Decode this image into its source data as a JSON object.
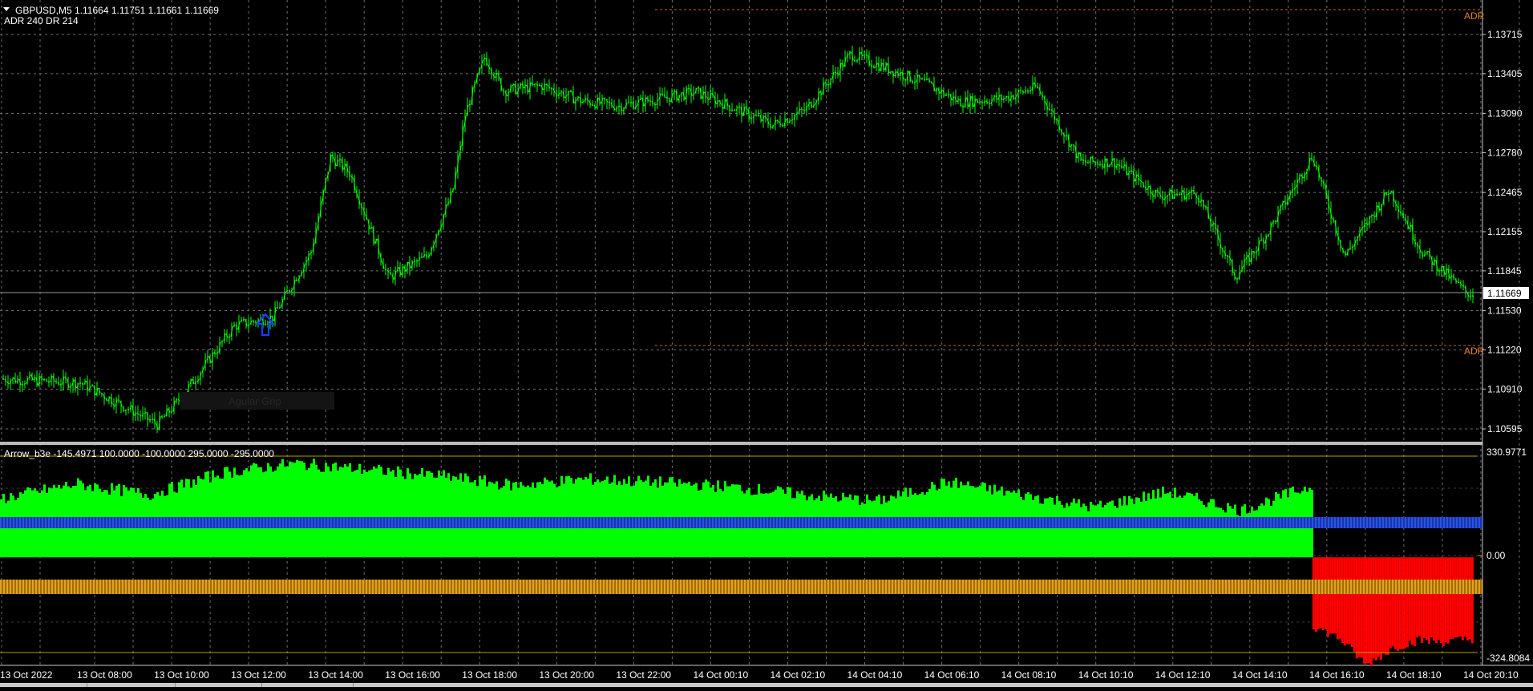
{
  "header": {
    "symbol_line": "GBPUSD,M5  1.11664 1.11751 1.11661 1.11669",
    "adr_line": "ADR 240  DR 214"
  },
  "price_axis": {
    "ticks": [
      "1.13715",
      "1.13405",
      "1.13090",
      "1.12780",
      "1.12465",
      "1.12155",
      "1.11845",
      "1.11530",
      "1.11220",
      "1.10910",
      "1.10595"
    ],
    "current_price": "1.11669"
  },
  "adr_labels": {
    "upper": "ADR",
    "lower": "ADR"
  },
  "faded_label": "Agular Grip",
  "indicator": {
    "title": "Arrow_b3e -145.4971 100.0000 -100.0000 295.0000 -295.0000",
    "axis_top": "330.9771",
    "axis_zero": "0.00",
    "axis_bottom": "-324.8084"
  },
  "time_axis": [
    "13 Oct 2022",
    "13 Oct 08:00",
    "13 Oct 10:00",
    "13 Oct 12:00",
    "13 Oct 14:00",
    "13 Oct 16:00",
    "13 Oct 18:00",
    "13 Oct 20:00",
    "13 Oct 22:00",
    "14 Oct 00:10",
    "14 Oct 02:10",
    "14 Oct 04:10",
    "14 Oct 06:10",
    "14 Oct 08:10",
    "14 Oct 10:10",
    "14 Oct 12:10",
    "14 Oct 14:10",
    "14 Oct 16:10",
    "14 Oct 18:10",
    "14 Oct 20:10"
  ],
  "colors": {
    "background": "#000000",
    "grid": "#8c8c8c",
    "candles": "#00ff00",
    "histogram_positive": "#00ff00",
    "histogram_negative": "#ff0000",
    "blue_level": "#1e3cc8",
    "orange_level": "#e6a21e",
    "adr_line": "#c8641e",
    "yellow_bounds": "#b4a000",
    "text": "#ffffff",
    "arrow": "#1a3cff"
  },
  "icons": {
    "signal_arrow": "up-arrow-icon",
    "menu_toggle": "triangle-down-icon"
  },
  "chart_data": [
    {
      "type": "candlestick",
      "title": "GBPUSD,M5",
      "ylim": [
        1.10595,
        1.13715
      ],
      "x_start": "13 Oct 2022",
      "x_end": "14 Oct 20:10",
      "last": 1.11669,
      "close_path": [
        [
          "13 Oct 2022",
          1.1099
        ],
        [
          "13 Oct 08:00",
          1.1096
        ],
        [
          "13 Oct 10:00",
          1.1063
        ],
        [
          "13 Oct 10:30",
          1.108
        ],
        [
          "13 Oct 12:00",
          1.1141
        ],
        [
          "13 Oct 13:00",
          1.1148
        ],
        [
          "13 Oct 14:00",
          1.12
        ],
        [
          "13 Oct 14:30",
          1.1275
        ],
        [
          "13 Oct 15:00",
          1.1262
        ],
        [
          "13 Oct 16:00",
          1.1179
        ],
        [
          "13 Oct 17:00",
          1.1196
        ],
        [
          "13 Oct 17:40",
          1.1247
        ],
        [
          "13 Oct 18:00",
          1.1309
        ],
        [
          "13 Oct 18:30",
          1.1354
        ],
        [
          "13 Oct 19:00",
          1.1327
        ],
        [
          "13 Oct 20:00",
          1.1331
        ],
        [
          "13 Oct 21:00",
          1.1319
        ],
        [
          "13 Oct 22:00",
          1.1315
        ],
        [
          "14 Oct 00:10",
          1.1326
        ],
        [
          "14 Oct 02:10",
          1.13
        ],
        [
          "14 Oct 03:00",
          1.1312
        ],
        [
          "14 Oct 04:10",
          1.1356
        ],
        [
          "14 Oct 06:10",
          1.1332
        ],
        [
          "14 Oct 07:00",
          1.1318
        ],
        [
          "14 Oct 08:10",
          1.1321
        ],
        [
          "14 Oct 09:00",
          1.133
        ],
        [
          "14 Oct 10:10",
          1.127
        ],
        [
          "14 Oct 11:00",
          1.1271
        ],
        [
          "14 Oct 12:10",
          1.1244
        ],
        [
          "14 Oct 13:10",
          1.1246
        ],
        [
          "14 Oct 14:10",
          1.118
        ],
        [
          "14 Oct 15:00",
          1.1215
        ],
        [
          "14 Oct 16:10",
          1.1276
        ],
        [
          "14 Oct 17:00",
          1.1196
        ],
        [
          "14 Oct 18:10",
          1.1249
        ],
        [
          "14 Oct 19:00",
          1.12
        ],
        [
          "14 Oct 20:10",
          1.11669
        ]
      ],
      "adr_high": 1.1399,
      "adr_low": 1.1121
    },
    {
      "type": "bar",
      "title": "Arrow_b3e -145.4971 100.0000 -100.0000 295.0000 -295.0000",
      "ylim": [
        -324.8084,
        330.9771
      ],
      "levels": [
        100,
        -100
      ],
      "bounds": [
        295,
        -295
      ],
      "positive_series_range": {
        "from": "13 Oct 2022",
        "to": "14 Oct 16:10",
        "values_approx": [
          190,
          235,
          200,
          270,
          300,
          280,
          260,
          230,
          250,
          240,
          225,
          200,
          180,
          240,
          200,
          160,
          210,
          150,
          230
        ]
      },
      "negative_series_range": {
        "from": "14 Oct 16:10",
        "to": "14 Oct 20:10",
        "values_approx": [
          -220,
          -260,
          -345,
          -290,
          -265,
          -270,
          -260
        ]
      }
    }
  ]
}
